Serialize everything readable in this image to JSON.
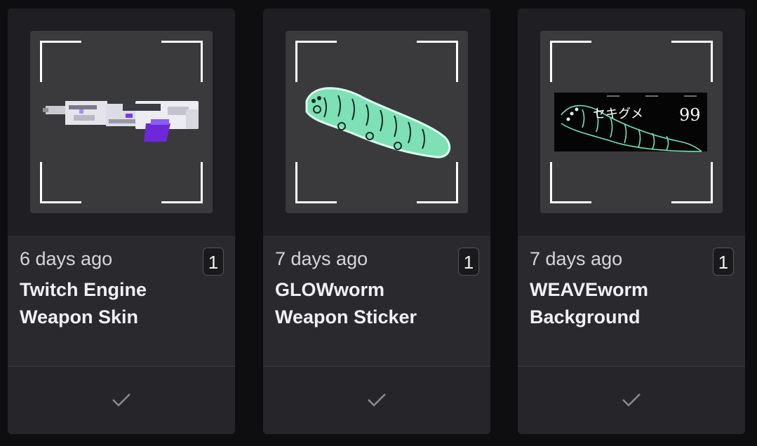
{
  "cards": [
    {
      "time": "6 days ago",
      "title": "Twitch Engine Weapon Skin",
      "qty": "1",
      "image_icon": "weapon-skin-rifle-icon",
      "status_icon": "check-icon"
    },
    {
      "time": "7 days ago",
      "title": "GLOWworm Weapon Sticker",
      "qty": "1",
      "image_icon": "glowing-worm-sticker-icon",
      "status_icon": "check-icon"
    },
    {
      "time": "7 days ago",
      "title": "WEAVEworm Background",
      "qty": "1",
      "image_icon": "worm-background-banner-icon",
      "status_icon": "check-icon",
      "banner_number": "99",
      "banner_glyphs": "セキグメ"
    }
  ],
  "colors": {
    "card_bg": "#1f1f23",
    "info_bg": "#2a2a2e",
    "thumb_bg": "#3a3a3d",
    "worm_green": "#6ee7b7",
    "skin_purple": "#6d28d9"
  }
}
